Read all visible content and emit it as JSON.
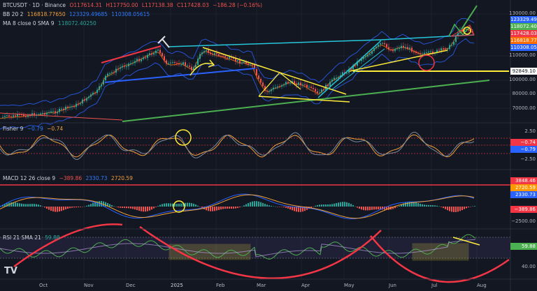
{
  "main": {
    "symbol": "BTCUSDT · 1D · Binance",
    "open": "O117614.31",
    "high": "H117750.00",
    "low": "L117138.38",
    "close": "C117428.03",
    "change": "−186.28 (−0.16%)",
    "bb_label": "BB 20 2",
    "bb_basis": "116818.77650",
    "bb_upper": "123329.49685",
    "bb_lower": "110308.05615",
    "ma_label": "MA 8 close 0 SMA 9",
    "ma_value": "118072.40250",
    "price_labels": [
      "123329.49",
      "118072.40",
      "117428.03",
      "116818.77",
      "110308.05",
      "92849.10"
    ],
    "price_label_colors": [
      "#2962ff",
      "#4caf50",
      "#f23645",
      "#ff6d00",
      "#2962ff",
      "#ffffff"
    ],
    "axis_ticks": [
      "130000.00",
      "110000.00",
      "100000.00",
      "80000.00",
      "70000.00"
    ]
  },
  "fisher": {
    "label": "Fisher 9",
    "v1": "−0.79",
    "v2": "−0.74",
    "labels": [
      "−0.74",
      "−0.79"
    ],
    "label_colors": [
      "#f23645",
      "#2962ff"
    ],
    "axis_ticks": [
      "2.50",
      "−2.50"
    ]
  },
  "macd": {
    "label": "MACD 12 26 close 9",
    "hist": "−389.86",
    "macd": "2330.73",
    "signal": "2720.59",
    "labels": [
      "3848.46",
      "2720.59",
      "2330.73",
      "−389.86"
    ],
    "label_colors": [
      "#f23645",
      "#ff9800",
      "#2962ff",
      "#f23645"
    ],
    "axis_ticks": [
      "−2500.00"
    ]
  },
  "rsi": {
    "label": "RSI 21 SMA 21",
    "value": "59.88",
    "labels": [
      "59.88"
    ],
    "label_colors": [
      "#4caf50"
    ],
    "axis_ticks": [
      "40.00"
    ]
  },
  "time_axis": [
    "Oct",
    "Nov",
    "Dec",
    "2025",
    "Feb",
    "Mar",
    "Apr",
    "May",
    "Jun",
    "Jul",
    "Aug"
  ],
  "logo": "TV",
  "colors": {
    "background": "#131722",
    "up": "#26a69a",
    "down": "#ef5350",
    "trend": "#ffeb3b"
  }
}
